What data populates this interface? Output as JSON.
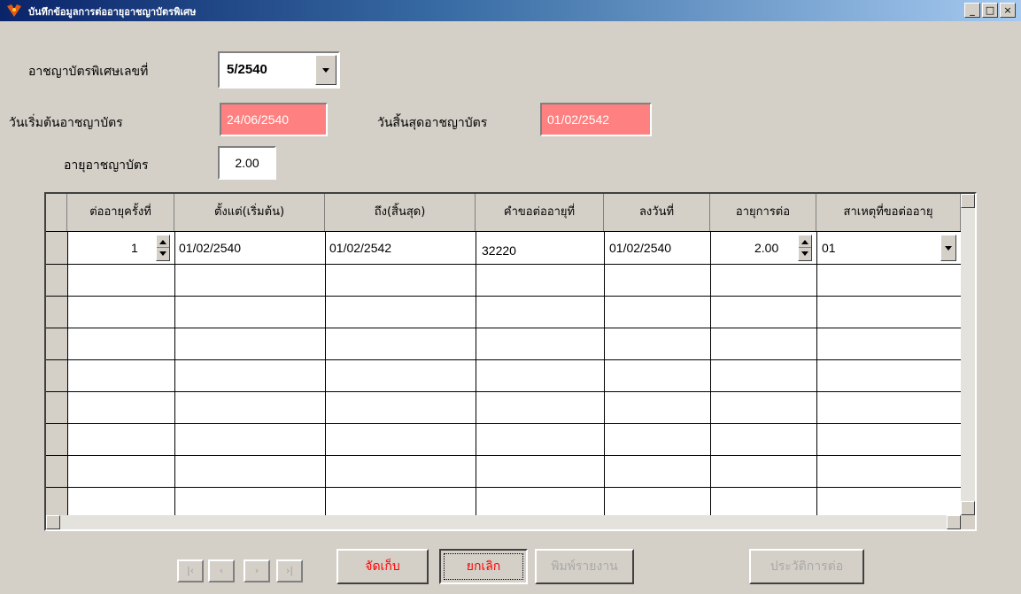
{
  "window": {
    "title": "บันทึกข้อมูลการต่ออายุอาชญาบัตรพิเศษ",
    "controls": [
      "_",
      "□",
      "×"
    ]
  },
  "form": {
    "license_no_label": "อาชญาบัตรพิเศษเลขที่",
    "license_no_value": "5/2540",
    "start_date_label": "วันเริ่มต้นอาชญาบัตร",
    "start_date_value": "24/06/2540",
    "end_date_label": "วันสิ้นสุดอาชญาบัตร",
    "end_date_value": "01/02/2542",
    "age_label": "อายุอาชญาบัตร",
    "age_value": "2.00"
  },
  "grid": {
    "columns": [
      "ต่ออายุครั้งที่",
      "ตั้งแต่(เริ่มต้น)",
      "ถึง(สิ้นสุด)",
      "คำขอต่ออายุที่",
      "ลงวันที่",
      "อายุการต่อ",
      "สาเหตุที่ขอต่ออายุ"
    ],
    "rows": [
      {
        "no": "1",
        "from": "01/02/2540",
        "to": "01/02/2542",
        "request_no": "32220",
        "date": "01/02/2540",
        "duration": "2.00",
        "reason": "01"
      }
    ]
  },
  "nav": [
    "|‹",
    "‹",
    "›",
    "›|"
  ],
  "buttons": {
    "save": "จัดเก็บ",
    "cancel": "ยกเลิก",
    "record": "พิมพ์รายงาน",
    "history": "ประวัติการต่อ"
  },
  "colors": {
    "highlight_field": "#ff8080",
    "accent_text": "#ff0000"
  }
}
